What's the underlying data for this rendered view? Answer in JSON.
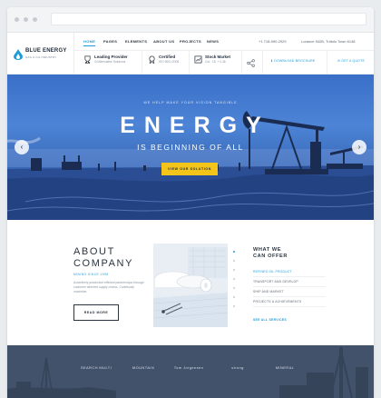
{
  "header": {
    "logo_title": "BLUE ENERGY",
    "logo_subtitle": "GAS & OIL INDUSTRY",
    "nav": [
      "HOME",
      "PAGES",
      "ELEMENTS",
      "ABOUT US",
      "PROJECTS",
      "NEWS"
    ],
    "phone": "+1 718-990-2929",
    "address": "Lorance 542B, Tuttolo Town 6148",
    "info": [
      {
        "icon": "trophy-icon",
        "title": "Leading Provider",
        "subtitle": "Of Alternative Solutions"
      },
      {
        "icon": "certificate-icon",
        "title": "Certified",
        "subtitle": "ISO 9001:2008"
      },
      {
        "icon": "chart-icon",
        "title": "Stock Market",
        "subtitle": "Cot.: 18.  + 0.36"
      }
    ],
    "download_label": "DOWNLOAD BROCHURE",
    "quote_label": "GET A QUOTE"
  },
  "hero": {
    "tagline": "WE HELP MAKE YOUR VISION TANGIBLE",
    "title": "ENERGY",
    "subtitle": "IS BEGINNING OF ALL",
    "button_label": "VIEW OUR SOLUTION",
    "prev": "‹",
    "next": "›"
  },
  "about": {
    "title_line1": "ABOUT",
    "title_line2": "COMPANY",
    "since": "MINING SINCE 1998",
    "text": "Assertively productize efficient partnerships through customer directed supply chains. Continually maximize.",
    "button_label": "READ MORE"
  },
  "offer": {
    "title_line1": "WHAT WE",
    "title_line2": "CAN OFFER",
    "items": [
      "REFINED OIL PRODUCT",
      "TRANSPORT AND DEVELOP",
      "SHIP AND MARKET",
      "PROJECTS & ACHIEVEMENTS"
    ],
    "link_label": "SEE ALL SERVICES"
  },
  "partners": [
    "SEARCH MULTI",
    "MOUNTAIN",
    "Tom Jorgensen",
    "strong",
    "MINERAL"
  ],
  "colors": {
    "accent": "#1f9bd7",
    "button": "#f3c41a",
    "dark": "#42526b"
  }
}
